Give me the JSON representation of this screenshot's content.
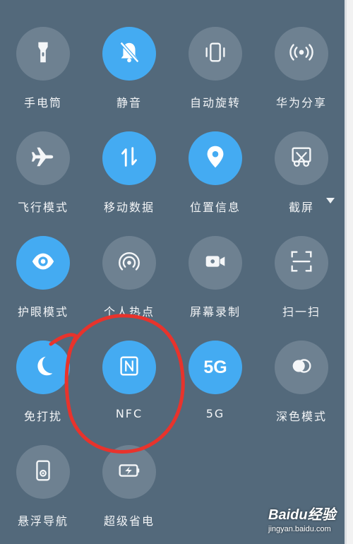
{
  "tiles": [
    {
      "label": "手电筒",
      "icon": "flashlight-icon",
      "active": false
    },
    {
      "label": "静音",
      "icon": "bell-off-icon",
      "active": true
    },
    {
      "label": "自动旋转",
      "icon": "auto-rotate-icon",
      "active": false
    },
    {
      "label": "华为分享",
      "icon": "huawei-share-icon",
      "active": false
    },
    {
      "label": "飞行模式",
      "icon": "airplane-icon",
      "active": false
    },
    {
      "label": "移动数据",
      "icon": "mobile-data-icon",
      "active": true
    },
    {
      "label": "位置信息",
      "icon": "location-pin-icon",
      "active": true
    },
    {
      "label": "截屏",
      "icon": "screenshot-icon",
      "active": false
    },
    {
      "label": "护眼模式",
      "icon": "eye-icon",
      "active": true
    },
    {
      "label": "个人热点",
      "icon": "hotspot-icon",
      "active": false
    },
    {
      "label": "屏幕录制",
      "icon": "video-camera-icon",
      "active": false
    },
    {
      "label": "扫一扫",
      "icon": "scan-icon",
      "active": false
    },
    {
      "label": "免打扰",
      "icon": "moon-icon",
      "active": true
    },
    {
      "label": "NFC",
      "icon": "nfc-icon",
      "active": true
    },
    {
      "label": "5G",
      "icon": "5g-icon",
      "active": true
    },
    {
      "label": "深色模式",
      "icon": "dark-mode-icon",
      "active": false
    },
    {
      "label": "悬浮导航",
      "icon": "floating-nav-icon",
      "active": false
    },
    {
      "label": "超级省电",
      "icon": "battery-saver-icon",
      "active": false
    }
  ],
  "five_g_text": "5G",
  "watermark": {
    "brand": "Baidu经验",
    "url": "jingyan.baidu.com"
  },
  "colors": {
    "panel": "#53697b",
    "active": "#44abf2",
    "inactive": "#6e8191",
    "annotation": "#e8332c"
  }
}
